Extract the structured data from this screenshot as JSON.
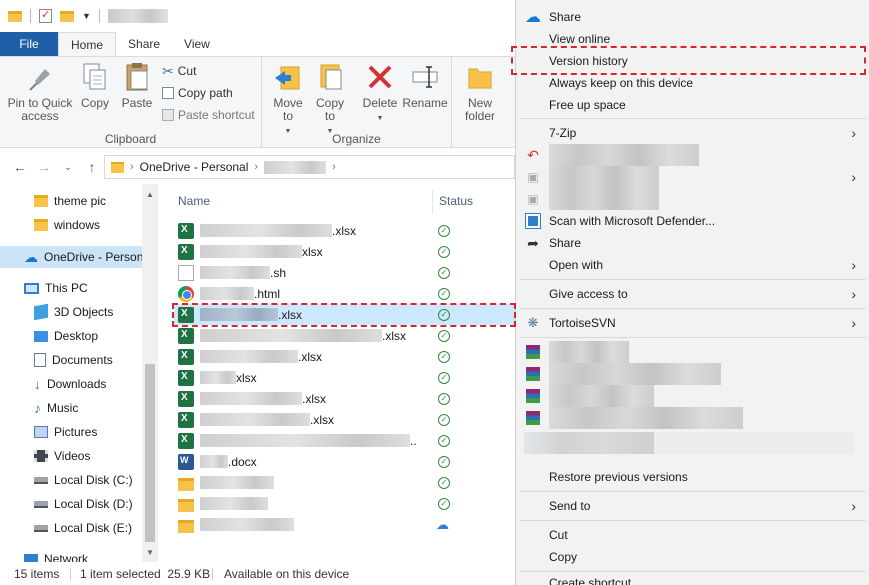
{
  "ribbon": {
    "tabs": [
      "File",
      "Home",
      "Share",
      "View"
    ],
    "clipboard": {
      "pin": "Pin to Quick access",
      "copy": "Copy",
      "paste": "Paste",
      "cut": "Cut",
      "copy_path": "Copy path",
      "paste_shortcut": "Paste shortcut",
      "group_label": "Clipboard"
    },
    "organize": {
      "move_to": "Move to",
      "copy_to": "Copy to",
      "delete": "Delete",
      "rename": "Rename",
      "group_label": "Organize"
    },
    "new": {
      "new_folder": "New folder"
    }
  },
  "address": {
    "root": "OneDrive - Personal"
  },
  "nav_pane": {
    "items": [
      "theme pic",
      "windows",
      "OneDrive - Personal",
      "This PC",
      "3D Objects",
      "Desktop",
      "Documents",
      "Downloads",
      "Music",
      "Pictures",
      "Videos",
      "Local Disk (C:)",
      "Local Disk (D:)",
      "Local Disk (E:)",
      "Network"
    ]
  },
  "file_list": {
    "columns": {
      "name": "Name",
      "status": "Status"
    },
    "rows": [
      {
        "icon": "excel-icon",
        "ext": ".xlsx",
        "status": "synced"
      },
      {
        "icon": "excel-icon",
        "ext": "xlsx",
        "status": "synced"
      },
      {
        "icon": "document-icon",
        "ext": ".sh",
        "status": "synced"
      },
      {
        "icon": "chrome-icon",
        "ext": ".html",
        "status": "synced"
      },
      {
        "icon": "excel-icon",
        "ext": ".xlsx",
        "status": "synced",
        "selected": true
      },
      {
        "icon": "excel-icon",
        "ext": ".xlsx",
        "status": "synced"
      },
      {
        "icon": "excel-icon",
        "ext": ".xlsx",
        "status": "synced"
      },
      {
        "icon": "excel-icon",
        "ext": "xlsx",
        "status": "synced"
      },
      {
        "icon": "excel-icon",
        "ext": ".xlsx",
        "status": "synced"
      },
      {
        "icon": "excel-icon",
        "ext": ".xlsx",
        "status": "synced"
      },
      {
        "icon": "excel-icon",
        "ext": "..",
        "status": "synced"
      },
      {
        "icon": "word-icon",
        "ext": ".docx",
        "status": "synced"
      },
      {
        "icon": "folder-icon",
        "ext": "",
        "status": "synced"
      },
      {
        "icon": "folder-icon",
        "ext": "",
        "status": "synced"
      },
      {
        "icon": "folder-icon",
        "ext": "",
        "status": "cloud"
      }
    ]
  },
  "status_bar": {
    "count": "15 items",
    "selection": "1 item selected  25.9 KB",
    "availability": "Available on this device"
  },
  "context_menu": {
    "share_onedrive": "Share",
    "view_online": "View online",
    "version_history": "Version history",
    "always_keep": "Always keep on this device",
    "free_up": "Free up space",
    "seven_zip": "7-Zip",
    "defender": "Scan with Microsoft Defender...",
    "share": "Share",
    "open_with": "Open with",
    "give_access": "Give access to",
    "tortoise": "TortoiseSVN",
    "restore": "Restore previous versions",
    "send_to": "Send to",
    "cut": "Cut",
    "copy": "Copy",
    "create_shortcut": "Create shortcut"
  },
  "colors": {
    "accent": "#1f5fa8",
    "highlight": "#d9262c",
    "selection": "#cce8ff",
    "synced": "#2e8b3a"
  }
}
